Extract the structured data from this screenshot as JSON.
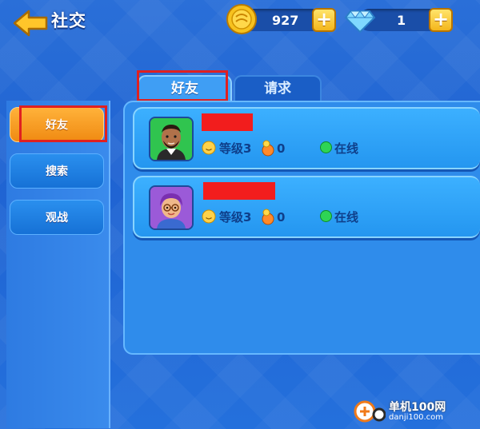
{
  "header": {
    "title": "社交"
  },
  "currency": {
    "coins": "927",
    "gems": "1"
  },
  "tabs": [
    {
      "label": "好友"
    },
    {
      "label": "请求"
    }
  ],
  "sidebar": {
    "items": [
      {
        "label": "好友"
      },
      {
        "label": "搜索"
      },
      {
        "label": "观战"
      }
    ]
  },
  "friends": [
    {
      "level": "等级3",
      "points": "0",
      "status": "在线"
    },
    {
      "level": "等级3",
      "points": "0",
      "status": "在线"
    }
  ],
  "watermark": {
    "brand": "单机100网",
    "url": "danji100.com"
  },
  "colors": {
    "highlight": "#e02020",
    "active_nav": "#f08a12",
    "online": "#2ed455"
  }
}
